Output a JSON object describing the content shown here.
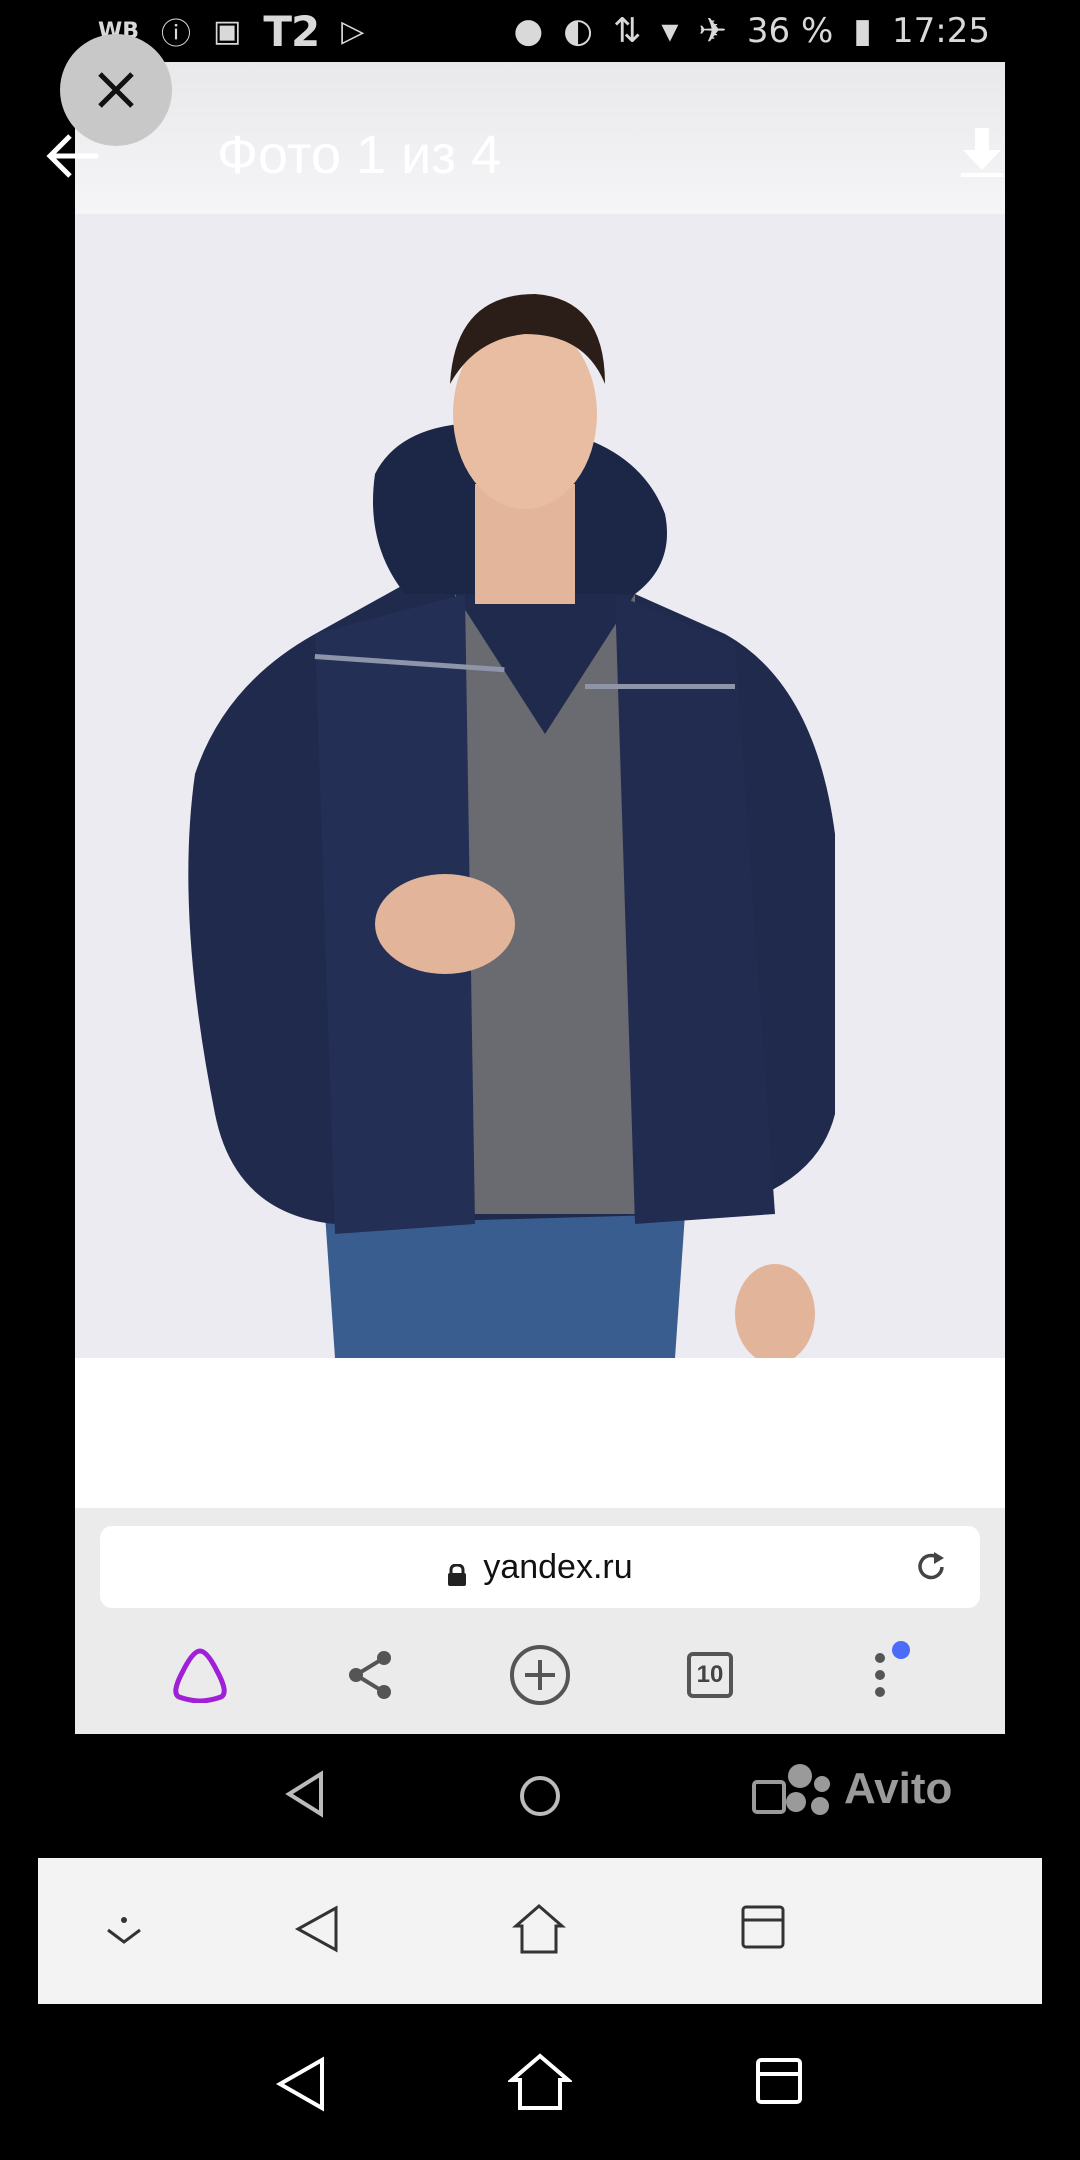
{
  "status_bar": {
    "wb": "WB",
    "carrier": "T2",
    "battery": "36 %",
    "time": "17:25"
  },
  "viewer": {
    "title": "Фото 1 из 4"
  },
  "browser": {
    "url": "yandex.ru",
    "tabs_count": "10"
  },
  "watermark": {
    "brand": "Avito"
  },
  "colors": {
    "alice_purple": "#a020d8",
    "notification_blue": "#4a6cf7"
  }
}
